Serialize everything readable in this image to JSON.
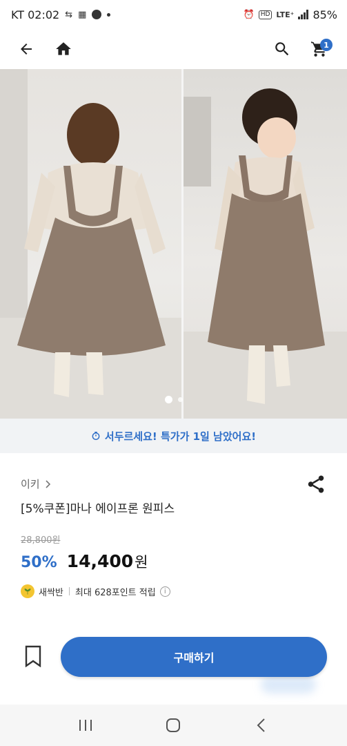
{
  "status_bar": {
    "carrier_time": "KT 02:02",
    "network": "LTE⁺",
    "hd": "HD",
    "battery": "85%"
  },
  "header": {
    "cart_count": "1"
  },
  "gallery": {
    "page_count": 2,
    "active_index": 0
  },
  "deal_banner": {
    "text": "서두르세요! 특가가 1일 남았어요!"
  },
  "product": {
    "brand": "이키",
    "name": "[5%쿠폰]마나 에이프론 원피스",
    "original_price": "28,800원",
    "discount": "50%",
    "price": "14,400",
    "price_unit": "원",
    "member_grade": "새싹반",
    "points_text": "최대 628포인트 적립"
  },
  "actions": {
    "buy_label": "구매하기"
  },
  "colors": {
    "accent": "#2f6fc8",
    "banner_bg": "#f1f3f5"
  }
}
